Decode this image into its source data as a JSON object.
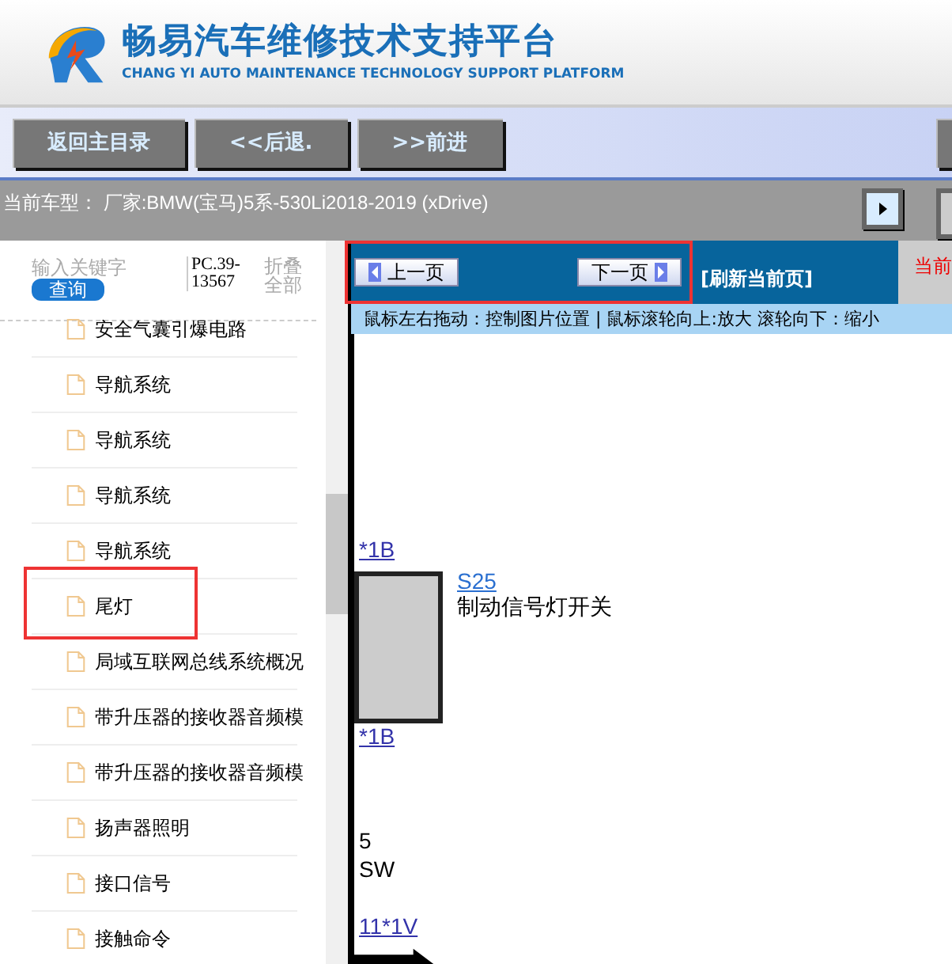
{
  "header": {
    "title": "畅易汽车维修技术支持平台",
    "subtitle": "CHANG YI AUTO MAINTENANCE TECHNOLOGY SUPPORT PLATFORM"
  },
  "toolbar": {
    "buttons": [
      "返回主目录",
      "<<后退.",
      ">>前进"
    ]
  },
  "vehicle_bar": {
    "text": "当前车型： 厂家:BMW(宝马)5系-530Li2018-2019 (xDrive)"
  },
  "sidebar": {
    "search": {
      "placeholder": "输入关键字",
      "button": "查询"
    },
    "code": "PC.39-13567",
    "collapse_all": "折叠全部",
    "items": [
      {
        "label": "安全气囊引爆电路",
        "highlighted": false
      },
      {
        "label": "导航系统",
        "highlighted": false
      },
      {
        "label": "导航系统",
        "highlighted": false
      },
      {
        "label": "导航系统",
        "highlighted": false
      },
      {
        "label": "导航系统",
        "highlighted": false
      },
      {
        "label": "尾灯",
        "highlighted": true
      },
      {
        "label": "局域互联网总线系统概况",
        "highlighted": false
      },
      {
        "label": "带升压器的接收器音频模",
        "highlighted": false
      },
      {
        "label": "带升压器的接收器音频模",
        "highlighted": false
      },
      {
        "label": "扬声器照明",
        "highlighted": false
      },
      {
        "label": "接口信号",
        "highlighted": false
      },
      {
        "label": "接触命令",
        "highlighted": false
      }
    ]
  },
  "viewer": {
    "prev_button": "上一页",
    "next_button": "下一页",
    "refresh": "[刷新当前页]",
    "current_label": "当前",
    "hint": "鼠标左右拖动：控制图片位置 | 鼠标滚轮向上:放大  滚轮向下：缩小",
    "diagram": {
      "top_ref": "*1B",
      "component_ref": "S25",
      "component_name": "制动信号灯开关",
      "ref_2": "*1B",
      "pin": "5",
      "wire": "SW",
      "ref_3": "11*1V"
    }
  }
}
